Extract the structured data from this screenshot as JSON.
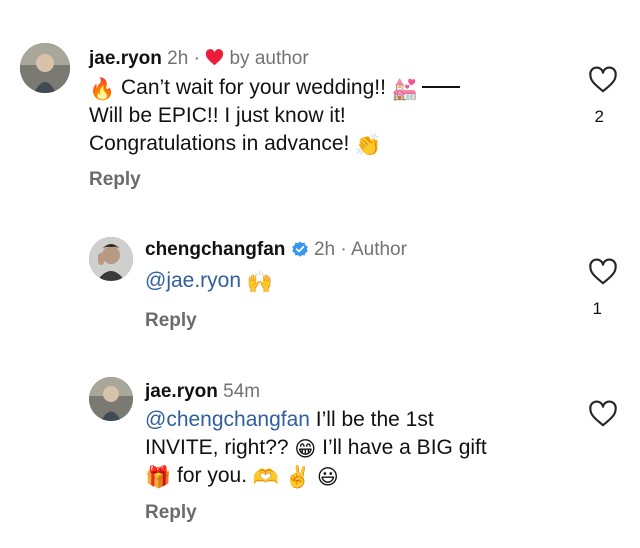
{
  "comments": [
    {
      "username": "jae.ryon",
      "time": "2h",
      "separator": "·",
      "liked_by_author": "by author",
      "lines": [
        {
          "emoji_start": "🔥",
          "text": " Can’t wait for your wedding!! ",
          "emoji_end": "💒",
          "dash": true
        },
        {
          "text": "Will be EPIC!! I just know it!"
        },
        {
          "text": "Congratulations in advance! ",
          "emoji_end": "👏"
        }
      ],
      "reply_label": "Reply",
      "likes": "2"
    },
    {
      "username": "chengchangfan",
      "verified": true,
      "time": "2h",
      "separator": "·",
      "role": "Author",
      "mention": "@jae.ryon",
      "emoji": "🙌",
      "reply_label": "Reply",
      "likes": "1"
    },
    {
      "username": "jae.ryon",
      "time": "54m",
      "mention": "@chengchangfan",
      "line1_text": " I’ll be the 1st",
      "line2_text_a": "INVITE, right?? ",
      "line2_emoji": "😁",
      "line2_text_b": " I’ll have a BIG gift",
      "line3_emoji_a": "🎁",
      "line3_text": " for you. ",
      "line3_emoji_b": "🫶",
      "line3_emoji_c": "✌️",
      "line3_emoji_d": "😃",
      "reply_label": "Reply"
    }
  ],
  "icons": {
    "like": "heart-outline-icon",
    "author_like": "red-heart-icon",
    "verified": "verified-badge-icon"
  },
  "colors": {
    "text": "#111111",
    "meta": "#737373",
    "mention": "#2f5f9e",
    "verified": "#3897f0",
    "heart_red": "#ed1c3a"
  }
}
